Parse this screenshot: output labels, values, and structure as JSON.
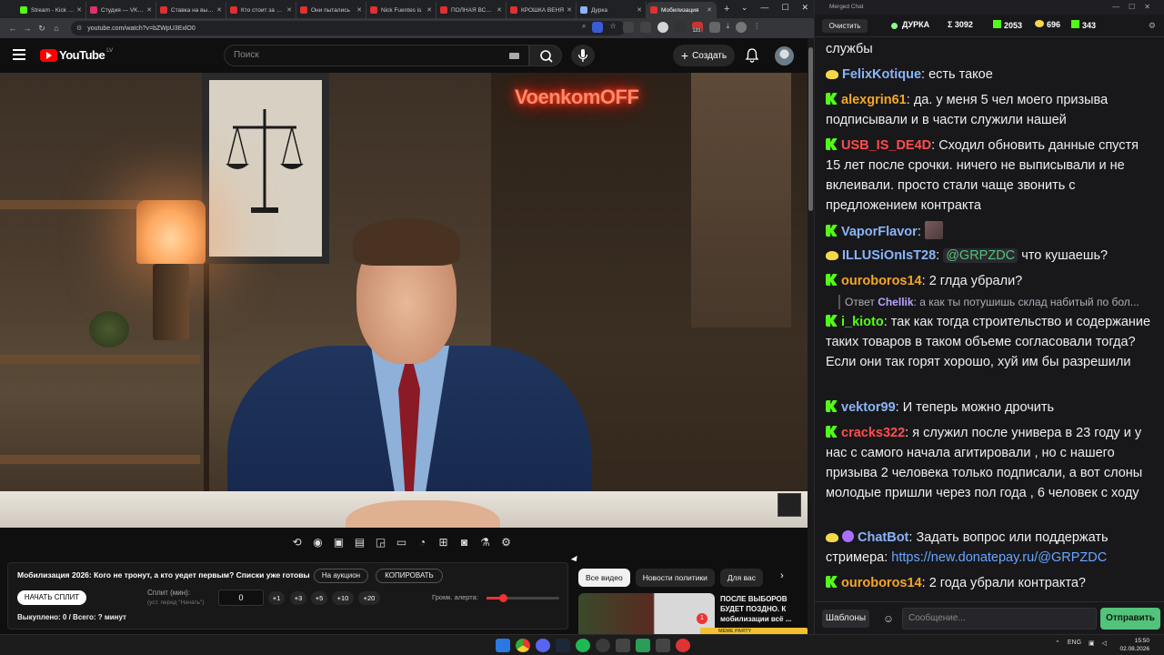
{
  "browser": {
    "tabs": [
      {
        "label": "Stream - Kick Dashboard",
        "color": "#53fc18"
      },
      {
        "label": "Студия — VK Видео",
        "color": "#e0306a"
      },
      {
        "label": "Ставка на выборы",
        "color": "#e03030"
      },
      {
        "label": "Кто стоит за этим",
        "color": "#e03030"
      },
      {
        "label": "Они пытались",
        "color": "#e03030"
      },
      {
        "label": "Nick Fuentes is",
        "color": "#e03030"
      },
      {
        "label": "ПОЛНАЯ ВСЕЛЕННАЯ",
        "color": "#e03030"
      },
      {
        "label": "КРОШКА ВЕНЯ",
        "color": "#e03030"
      },
      {
        "label": "Дурка",
        "color": "#8ab4f8"
      },
      {
        "label": "Мобилизация",
        "color": "#e03030",
        "active": true
      }
    ],
    "url": "youtube.com/watch?v=bZWpU3ExlO0",
    "ext_badge": "123"
  },
  "youtube": {
    "logo": "YouTube",
    "region": "LV",
    "search_placeholder": "Поиск",
    "create_label": "Создать",
    "video_neon_sign": "VoenkomOFF"
  },
  "split_panel": {
    "title": "Мобилизация 2026: Кого не тронут, а кто уедет первым? Списки уже готовы",
    "auction_btn": "На аукцион",
    "copy_btn": "КОПИРОВАТЬ",
    "start_split_btn": "НАЧАТЬ СПЛИТ",
    "split_label": "Сплит (мин):",
    "split_hint": "(уст. перед \"Начать\")",
    "split_value": "0",
    "increments": [
      "+1",
      "+3",
      "+5",
      "+10",
      "+20"
    ],
    "alert_volume_label": "Громк. алерта:",
    "alert_volume": 0.22,
    "bought_text": "Выкуплено: 0 / Всего: ? минут"
  },
  "recommended": {
    "chips": [
      "Все видео",
      "Новости политики",
      "Для вас"
    ],
    "video_title": "ПОСЛЕ ВЫБОРОВ БУДЕТ ПОЗДНО. К мобилизации всё ...",
    "thumb_badge": "1",
    "meme_bar_text": "MEME PARTY"
  },
  "chat": {
    "window_title": "Merged Chat",
    "clear_btn": "Очистить",
    "channel": "ДУРКА",
    "stats": [
      {
        "icon": "sigma",
        "value": "Σ 3092"
      },
      {
        "icon": "kick-icon",
        "value": "2053"
      },
      {
        "icon": "bird-icon",
        "value": "696"
      },
      {
        "icon": "k-icon",
        "value": "343"
      }
    ],
    "messages": [
      {
        "badge": "",
        "user": "",
        "color": "#efeff1",
        "text": "службы"
      },
      {
        "badge": "bird",
        "user": "FelixKotique",
        "color": "#8ab4f8",
        "text": "есть такое"
      },
      {
        "badge": "kick",
        "user": "alexgrin61",
        "color": "#f5a623",
        "text": "да. у меня 5 чел моего призыва подписывали и  в части служили нашей"
      },
      {
        "badge": "kick",
        "user": "USB_IS_DE4D",
        "color": "#ff4d4d",
        "text": "Сходил обновить данные спустя 15 лет после срочки. ничего не выписывали и не вклеивали. просто стали чаще звонить с предложением контракта"
      },
      {
        "badge": "kick",
        "user": "VaporFlavor",
        "color": "#8ab4f8",
        "text": ""
      },
      {
        "badge": "bird",
        "user": "ILLUSiOnIsT28",
        "color": "#8ab4f8",
        "mention": "@GRPZDC",
        "text": "что кушаешь?"
      },
      {
        "badge": "kick",
        "user": "ouroboros14",
        "color": "#f5a623",
        "text": "2 глда убрали?"
      },
      {
        "badge": "kick",
        "user": "i_kioto",
        "color": "#53fc18",
        "text": "так как тогда строительство и содержание таких товаров в таком объеме согласовали тогда? Если они так горят хорошо, хуй им бы разрешили"
      },
      {
        "badge": "kick",
        "user": "vektor99",
        "color": "#8ab4f8",
        "text": "И теперь можно дрочить"
      },
      {
        "badge": "kick",
        "user": "cracks322",
        "color": "#ff4d4d",
        "text": "я служил после универа в 23 году и у нас с самого начала агитировали , но с нашего призыва 2 человека только подписали, а вот слоны молодые пришли через пол года , 6 человек с ходу"
      },
      {
        "badge": "bot",
        "user": "ChatBot",
        "color": "#8ab4f8",
        "text": "Задать вопрос или поддержать стримера:",
        "link": "https://new.donatepay.ru/@GRPZDC"
      },
      {
        "badge": "kick",
        "user": "ouroboros14",
        "color": "#f5a623",
        "text": "2 года убрали контракта?"
      }
    ],
    "reply": {
      "prefix": "Ответ",
      "user": "Chellik",
      "text": "а как ты потушишь склад набитый по бол..."
    },
    "templates_btn": "Шаблоны",
    "input_placeholder": "Сообщение...",
    "send_btn": "Отправить"
  },
  "taskbar": {
    "lang": "ENG",
    "time": "15:50",
    "date": "02.08.2026"
  }
}
